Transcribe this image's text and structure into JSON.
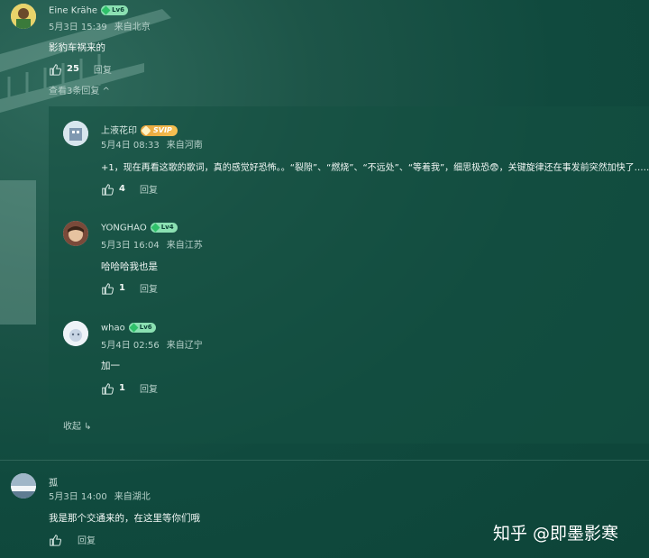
{
  "comments": [
    {
      "name": "Eine Krähe",
      "level": "Lv6",
      "date": "5月3日 15:39",
      "location": "来自北京",
      "text": "影豹车祸来的",
      "likes": "25",
      "reply": "回复"
    },
    {
      "name": "孤",
      "date": "5月3日 14:00",
      "location": "来自湖北",
      "text": "我是那个交通来的，在这里等你们哦",
      "reply": "回复"
    }
  ],
  "thread": {
    "toggle_label": "查看3条回复 ^",
    "collapse_label": "收起 ↳",
    "replies": [
      {
        "name": "上液花印",
        "badge": "SVIP",
        "date": "5月4日 08:33",
        "location": "来自河南",
        "text": "+1，现在再看这歌的歌词，真的感觉好恐怖。。“裂隙”、“燃烧”、“不远处”、“等着我”，细思极恐😨，关键旋律还在事发前突然加快了……",
        "likes": "4",
        "reply": "回复"
      },
      {
        "name": "YONGHAO",
        "level": "Lv4",
        "date": "5月3日 16:04",
        "location": "来自江苏",
        "text": "哈哈哈我也是",
        "likes": "1",
        "reply": "回复"
      },
      {
        "name": "whao",
        "level": "Lv6",
        "date": "5月4日 02:56",
        "location": "来自辽宁",
        "text": "加一",
        "likes": "1",
        "reply": "回复"
      }
    ]
  },
  "watermark": {
    "logo": "知乎",
    "author": "@即墨影寒"
  },
  "colors": {
    "background": "#0d4438",
    "badge": "#8be0b2",
    "svip": "#f6c153"
  }
}
